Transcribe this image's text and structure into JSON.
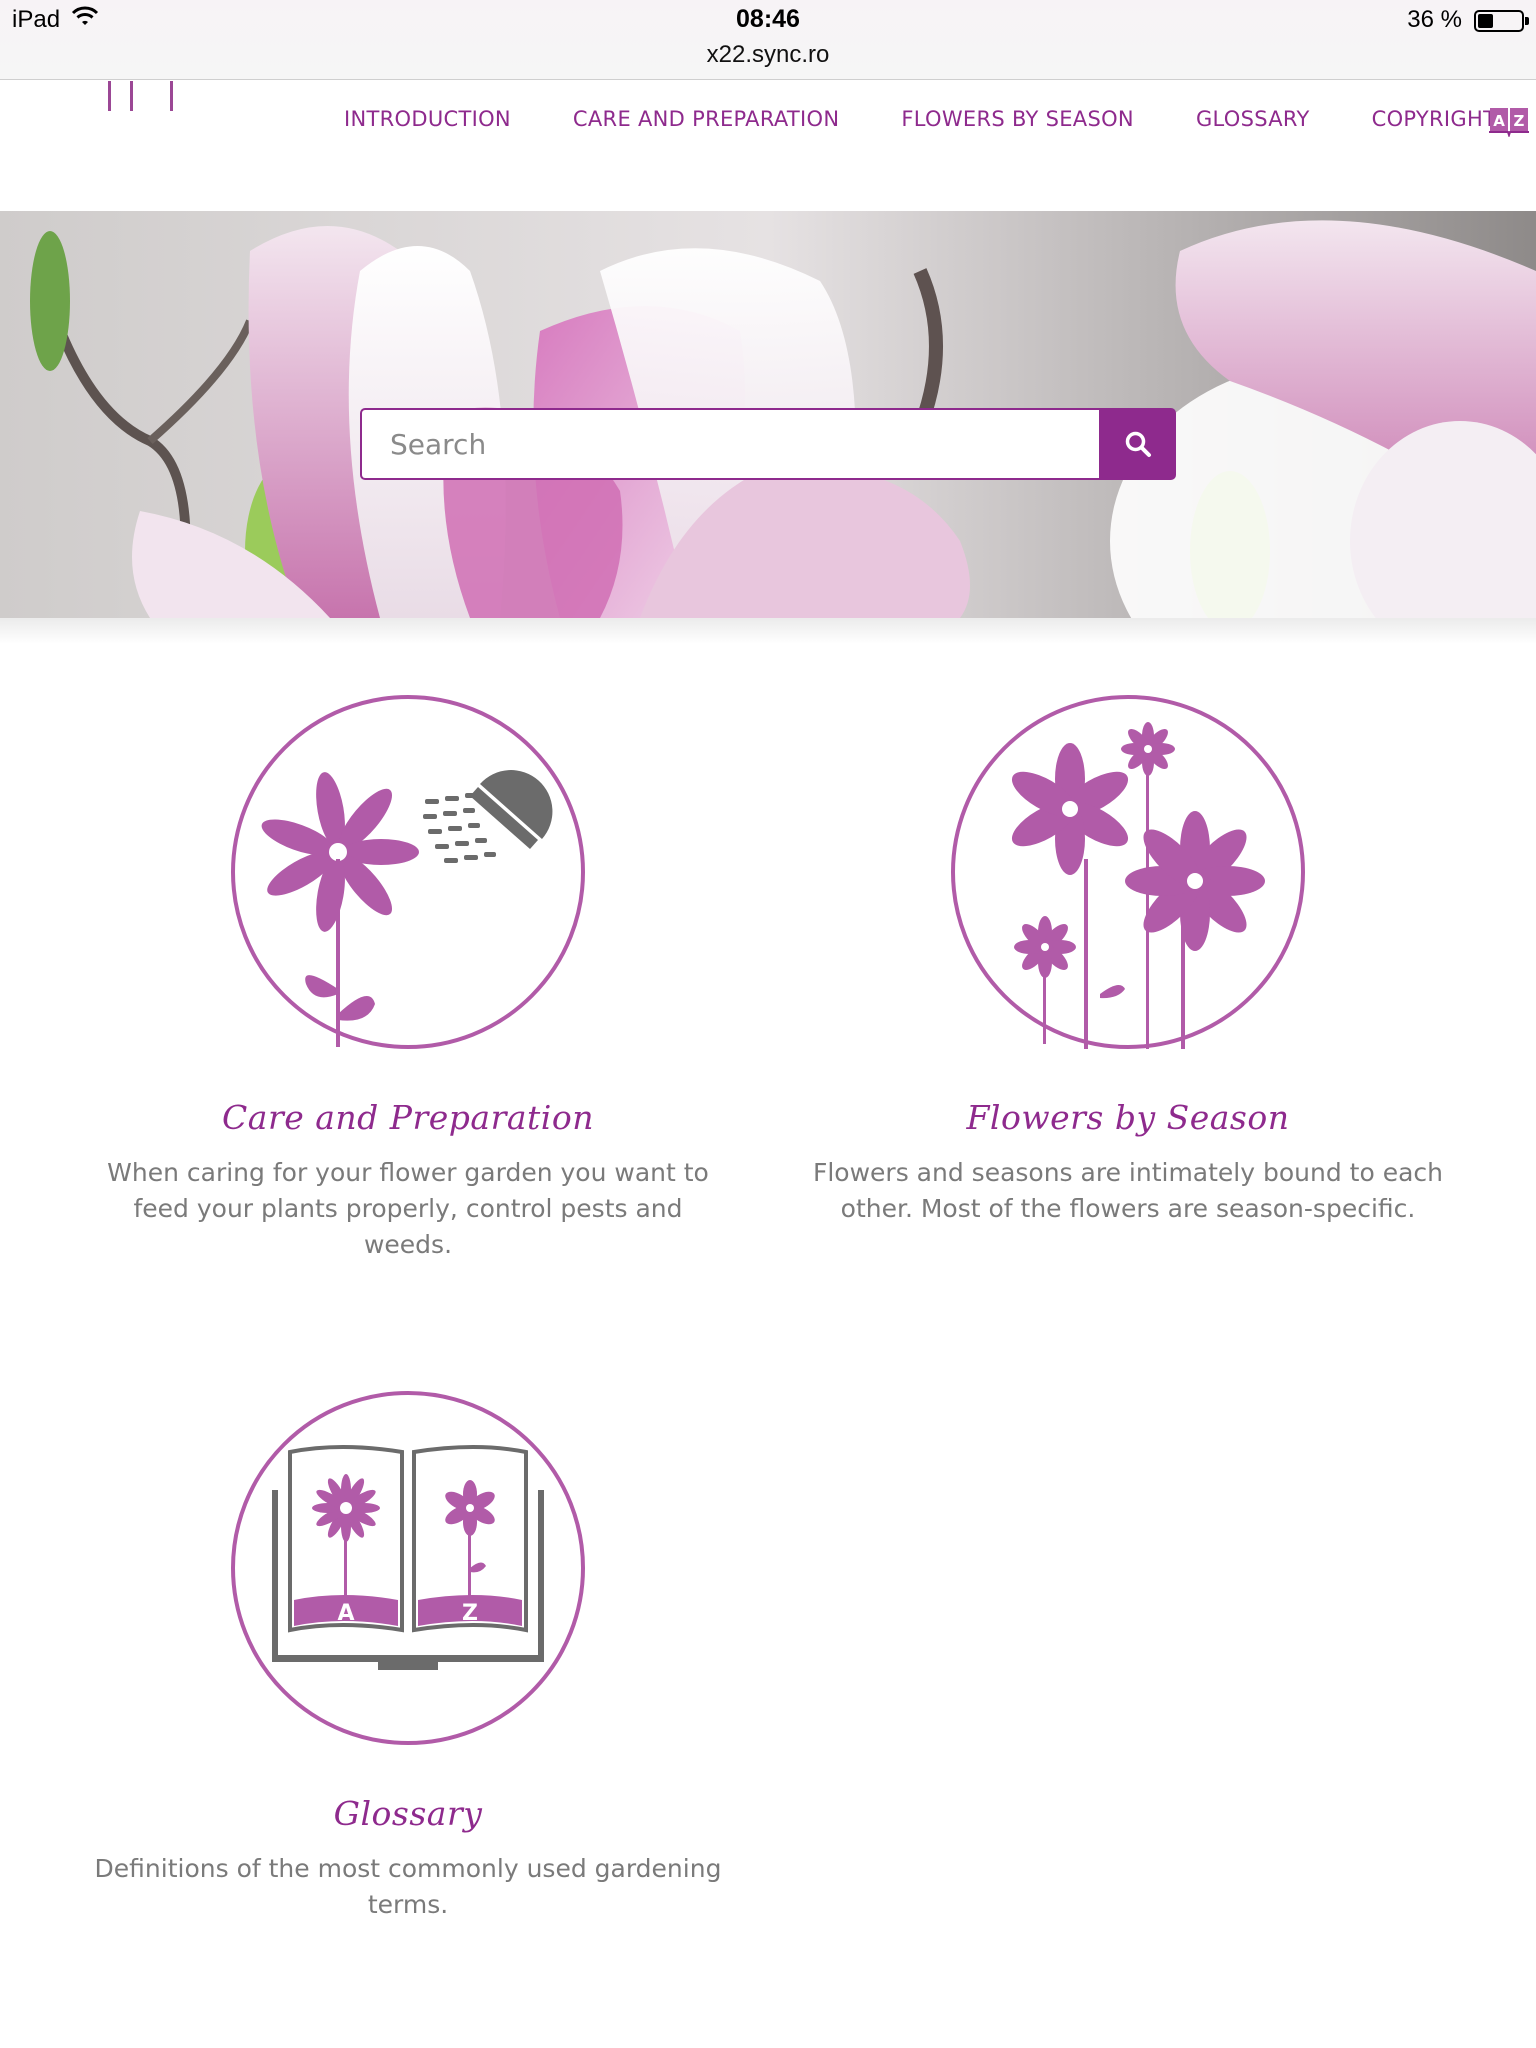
{
  "status_bar": {
    "device": "iPad",
    "time": "08:46",
    "url": "x22.sync.ro",
    "battery": "36 %",
    "battery_level": 0.36
  },
  "nav": {
    "items": [
      {
        "label": "INTRODUCTION"
      },
      {
        "label": "CARE AND PREPARATION"
      },
      {
        "label": "FLOWERS BY SEASON"
      },
      {
        "label": "GLOSSARY"
      },
      {
        "label": "COPYRIGHT"
      }
    ],
    "az_icon": "book-az-icon"
  },
  "search": {
    "placeholder": "Search",
    "button_icon": "search-icon"
  },
  "tiles": [
    {
      "icon": "flower-watering-icon",
      "title": "Care and Preparation",
      "description": "When caring for your flower garden you want to feed your plants properly, control pests and weeds."
    },
    {
      "icon": "flowers-bouquet-icon",
      "title": "Flowers by Season",
      "description": "Flowers and seasons are intimately bound to each other. Most of the flowers are season-specific."
    },
    {
      "icon": "glossary-book-icon",
      "title": "Glossary",
      "description": "Definitions of the most commonly used gardening terms.",
      "book_letters": [
        "A",
        "Z"
      ]
    }
  ],
  "colors": {
    "accent": "#8e2a8d",
    "icon_purple": "#b15ba8",
    "icon_gray": "#6b6b6b",
    "text_gray": "#7a7a7a"
  }
}
